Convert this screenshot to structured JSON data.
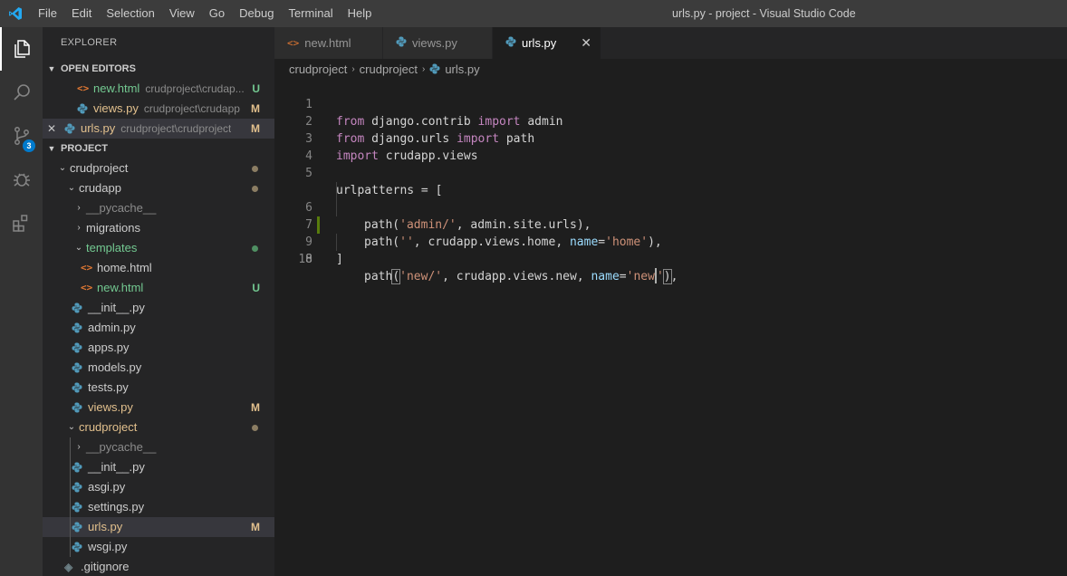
{
  "window": {
    "title": "urls.py - project - Visual Studio Code"
  },
  "menu": [
    "File",
    "Edit",
    "Selection",
    "View",
    "Go",
    "Debug",
    "Terminal",
    "Help"
  ],
  "activity_bar": {
    "scm_badge": "3"
  },
  "sidebar": {
    "header": "EXPLORER",
    "open_editors_title": "OPEN EDITORS",
    "open_editors": [
      {
        "name": "new.html",
        "desc": "crudproject\\crudap...",
        "status": "U",
        "type": "html"
      },
      {
        "name": "views.py",
        "desc": "crudproject\\crudapp",
        "status": "M",
        "type": "py"
      },
      {
        "name": "urls.py",
        "desc": "crudproject\\crudproject",
        "status": "M",
        "type": "py",
        "close": "✕"
      }
    ],
    "project_title": "PROJECT",
    "tree": [
      {
        "name": "crudproject",
        "status": ""
      },
      {
        "name": "crudapp",
        "status": ""
      },
      {
        "name": "__pycache__",
        "status": ""
      },
      {
        "name": "migrations",
        "status": ""
      },
      {
        "name": "templates",
        "status": ""
      },
      {
        "name": "home.html",
        "status": ""
      },
      {
        "name": "new.html",
        "status": "U"
      },
      {
        "name": "__init__.py",
        "status": ""
      },
      {
        "name": "admin.py",
        "status": ""
      },
      {
        "name": "apps.py",
        "status": ""
      },
      {
        "name": "models.py",
        "status": ""
      },
      {
        "name": "tests.py",
        "status": ""
      },
      {
        "name": "views.py",
        "status": "M"
      },
      {
        "name": "crudproject",
        "status": ""
      },
      {
        "name": "__pycache__",
        "status": ""
      },
      {
        "name": "__init__.py",
        "status": ""
      },
      {
        "name": "asgi.py",
        "status": ""
      },
      {
        "name": "settings.py",
        "status": ""
      },
      {
        "name": "urls.py",
        "status": "M"
      },
      {
        "name": "wsgi.py",
        "status": ""
      },
      {
        "name": ".gitignore",
        "status": ""
      }
    ]
  },
  "tabs": [
    {
      "label": "new.html",
      "type": "html"
    },
    {
      "label": "views.py",
      "type": "py"
    },
    {
      "label": "urls.py",
      "type": "py",
      "close": "✕"
    }
  ],
  "breadcrumb": [
    "crudproject",
    "crudproject",
    "urls.py"
  ],
  "editor": {
    "line_numbers": [
      "1",
      "2",
      "3",
      "4",
      "5",
      "6",
      "7",
      "8",
      "9",
      "10"
    ],
    "code": {
      "l1": [
        "from",
        " django.contrib ",
        "import",
        " admin"
      ],
      "l2": [
        "from",
        " django.urls ",
        "import",
        " path"
      ],
      "l3": [
        "import",
        " crudapp.views"
      ],
      "l5": "urlpatterns = [",
      "l6": [
        "path(",
        "'admin/'",
        ", admin.site.urls),"
      ],
      "l7": [
        "path(",
        "''",
        ", crudapp.views.home, ",
        "name",
        "=",
        "'home'",
        "),"
      ],
      "l8": [
        "path",
        "(",
        "'new/'",
        ", crudapp.views.new, ",
        "name",
        "=",
        "'new",
        "'",
        ")",
        ","
      ],
      "l9": "]"
    }
  }
}
